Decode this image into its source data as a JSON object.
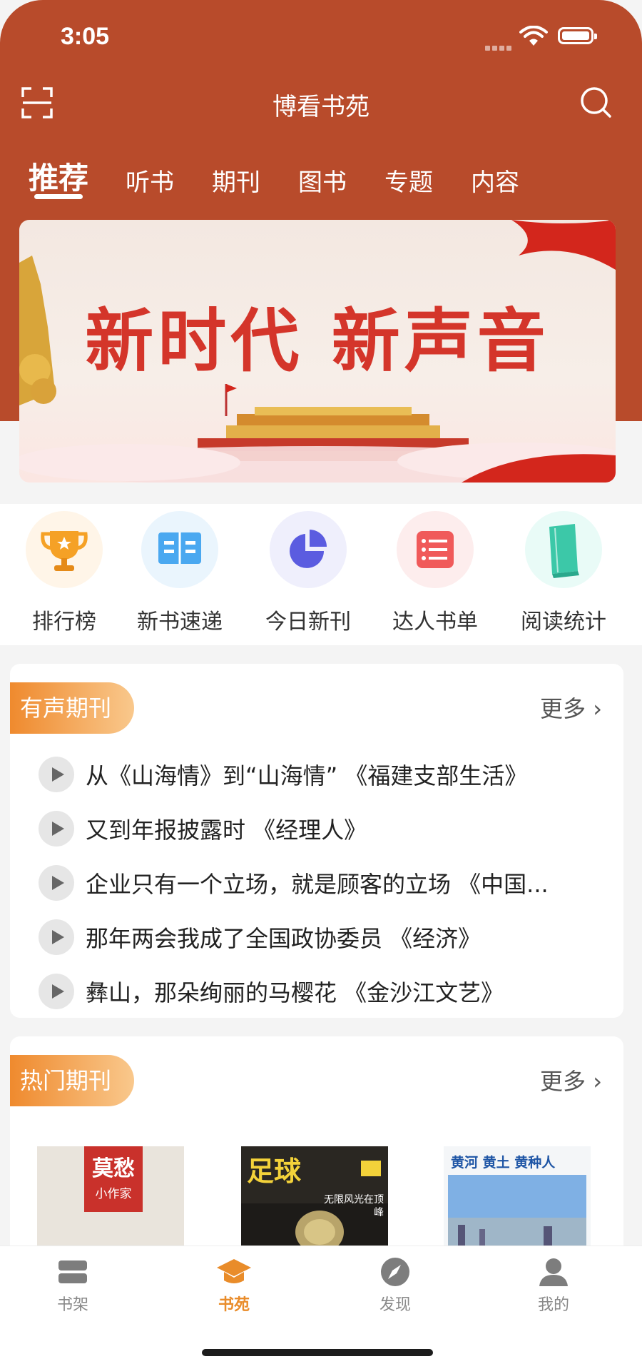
{
  "status_bar": {
    "time": "3:05"
  },
  "header": {
    "title": "博看书苑"
  },
  "tabs": [
    {
      "label": "推荐"
    },
    {
      "label": "听书"
    },
    {
      "label": "期刊"
    },
    {
      "label": "图书"
    },
    {
      "label": "专题"
    },
    {
      "label": "内容"
    }
  ],
  "banner": {
    "text": "新时代 新声音"
  },
  "quick_links": [
    {
      "label": "排行榜",
      "icon": "trophy-icon",
      "color": "#f5a126"
    },
    {
      "label": "新书速递",
      "icon": "open-book-icon",
      "color": "#4aa8f0"
    },
    {
      "label": "今日新刊",
      "icon": "pie-chart-icon",
      "color": "#5b5ce0"
    },
    {
      "label": "达人书单",
      "icon": "list-icon",
      "color": "#f05a5a"
    },
    {
      "label": "阅读统计",
      "icon": "book-stack-icon",
      "color": "#3cc8a8"
    }
  ],
  "audio_section": {
    "title": "有声期刊",
    "more": "更多",
    "items": [
      {
        "text": "从《山海情》到“山海情” 《福建支部生活》"
      },
      {
        "text": "又到年报披露时 《经理人》"
      },
      {
        "text": "企业只有一个立场，就是顾客的立场 《中国..."
      },
      {
        "text": "那年两会我成了全国政协委员 《经济》"
      },
      {
        "text": "彝山，那朵绚丽的马樱花 《金沙江文艺》"
      }
    ]
  },
  "hot_section": {
    "title": "热门期刊",
    "more": "更多",
    "covers": [
      {
        "title": "莫愁",
        "subtitle": "小作家"
      },
      {
        "title": "足球",
        "subtitle": "无限风光在顶峰"
      },
      {
        "title": "黄河 黄土 黄种人",
        "subtitle": ""
      }
    ]
  },
  "tab_bar": [
    {
      "label": "书架",
      "icon": "bookshelf-icon"
    },
    {
      "label": "书苑",
      "icon": "graduation-cap-icon",
      "active": true
    },
    {
      "label": "发现",
      "icon": "compass-icon"
    },
    {
      "label": "我的",
      "icon": "person-icon"
    }
  ],
  "colors": {
    "brand": "#b84b2b",
    "accent": "#e98c2a"
  }
}
